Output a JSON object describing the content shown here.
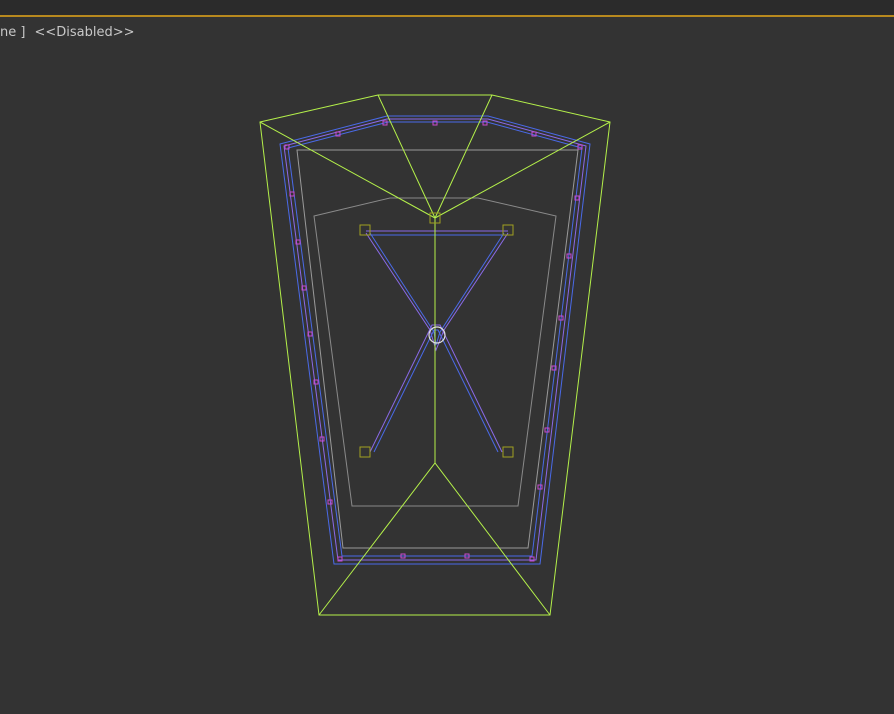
{
  "viewport": {
    "label_prefix": "ne ]",
    "label_status": "<<Disabled>>"
  },
  "colors": {
    "background": "#333333",
    "accent_line": "#b8891e",
    "selection_green": "#b4f04a",
    "spline_blue": "#4a6ae8",
    "spline_violet": "#8a6ae8",
    "vertex_magenta": "#c84ad0",
    "outline_gray": "#9a9a9a",
    "control_point": "#a0a020",
    "pivot_white": "#e0e0e0"
  },
  "icons": [
    "pivot-icon",
    "control-point-icon",
    "vertex-icon"
  ]
}
